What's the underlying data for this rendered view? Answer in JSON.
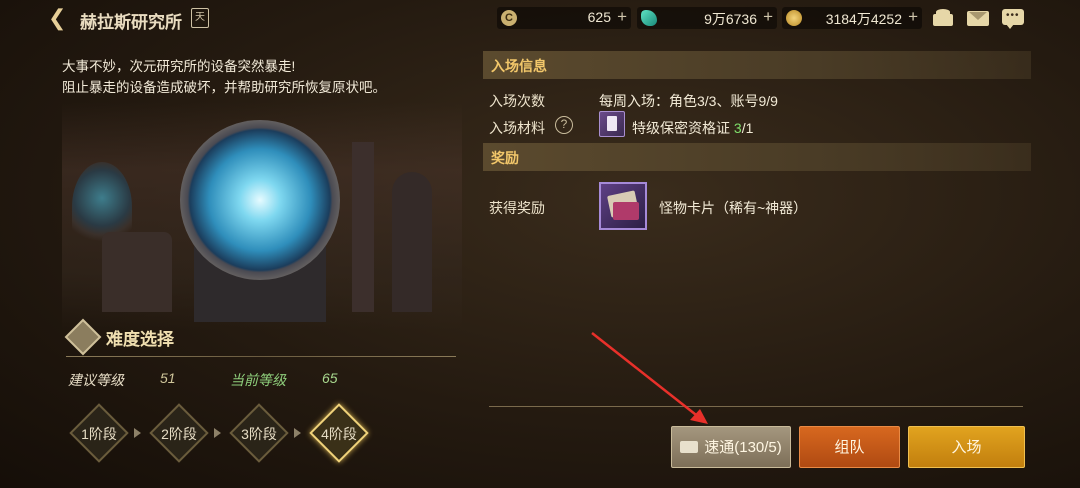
{
  "header": {
    "title": "赫拉斯研究所",
    "calendar_icon_text": "天",
    "currencies": [
      {
        "icon": "coin-c-icon",
        "value": "625",
        "plus": "+"
      },
      {
        "icon": "gem-icon",
        "value": "9万6736",
        "plus": "+"
      },
      {
        "icon": "gold-icon",
        "value": "3184万4252",
        "plus": "+"
      }
    ]
  },
  "intro": {
    "line1": "大事不妙，次元研究所的设备突然暴走!",
    "line2": "阻止暴走的设备造成破坏，并帮助研究所恢复原状吧。"
  },
  "difficulty": {
    "title": "难度选择",
    "recommended_label": "建议等级",
    "recommended_value": "51",
    "current_label": "当前等级",
    "current_value": "65",
    "stages": [
      "1阶段",
      "2阶段",
      "3阶段",
      "4阶段"
    ],
    "active_stage": 4
  },
  "entry_info": {
    "section_title": "入场信息",
    "count_label": "入场次数",
    "count_value": "每周入场：角色3/3、账号9/9",
    "material_label": "入场材料",
    "help_icon_text": "?",
    "material_name": "特级保密资格证",
    "material_have": "3",
    "material_need": "/1"
  },
  "reward": {
    "section_title": "奖励",
    "label": "获得奖励",
    "value": "怪物卡片（稀有~神器）"
  },
  "buttons": {
    "sweep": "速通(130/5)",
    "team": "组队",
    "enter": "入场"
  },
  "colors": {
    "section_title": "#f2c76a",
    "accent_green": "#7fe06b",
    "team_button": "#c65a18",
    "enter_button": "#d6921a",
    "annotation_arrow": "#e8302a"
  }
}
